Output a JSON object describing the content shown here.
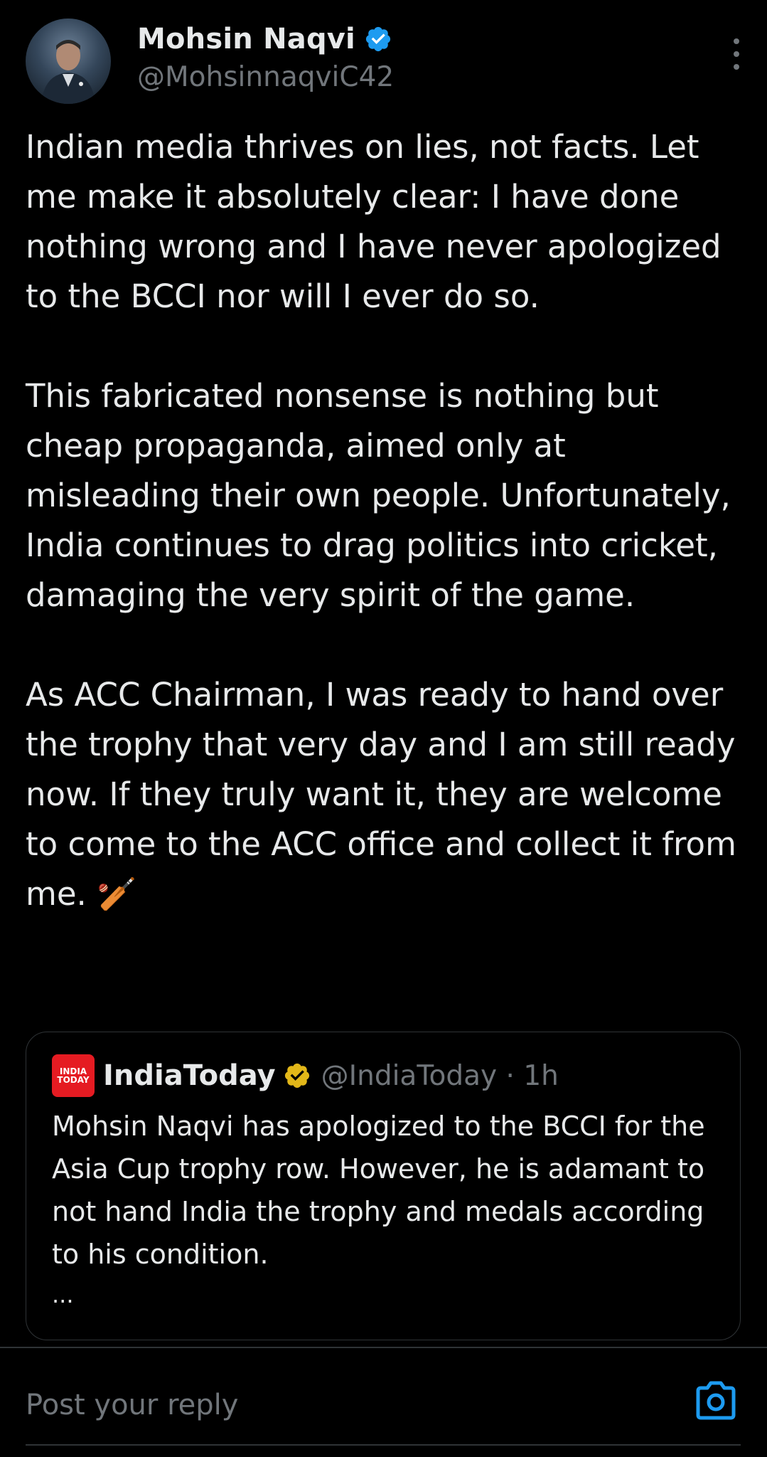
{
  "author": {
    "display_name": "Mohsin Naqvi",
    "handle": "@MohsinnaqviC42",
    "verified_icon": "verified-badge-blue",
    "avatar_icon": "profile-photo"
  },
  "tweet": {
    "text": "Indian media thrives on lies, not facts. Let me make it absolutely clear: I have done nothing wrong and I have never apologized to the BCCI nor will I ever do so.\n\nThis fabricated nonsense is nothing but cheap propaganda, aimed only at misleading their own people. Unfortunately, India continues to drag politics into cricket, damaging the very spirit of the game.\n\nAs ACC Chairman, I was ready to hand over the trophy that very day and I am still ready now. If they truly want it, they are welcome to come to the ACC office and collect it from me. 🏏"
  },
  "quoted_tweet": {
    "logo_line1": "INDIA",
    "logo_line2": "TODAY",
    "display_name": "IndiaToday",
    "verified_icon": "verified-badge-gold",
    "handle_time": "@IndiaToday · 1h",
    "text": "Mohsin Naqvi has apologized to the BCCI for the Asia Cup trophy row. However, he is adamant to not hand India the trophy and medals according to his condition.",
    "ellipsis": "..."
  },
  "reply": {
    "placeholder": "Post your reply",
    "camera_icon": "camera-icon"
  },
  "colors": {
    "background": "#000000",
    "text": "#e7e9ea",
    "secondary_text": "#71767b",
    "accent": "#1d9bf0",
    "border": "#2f3336",
    "gold_badge": "#e2b719",
    "india_today_red": "#e51b22"
  }
}
